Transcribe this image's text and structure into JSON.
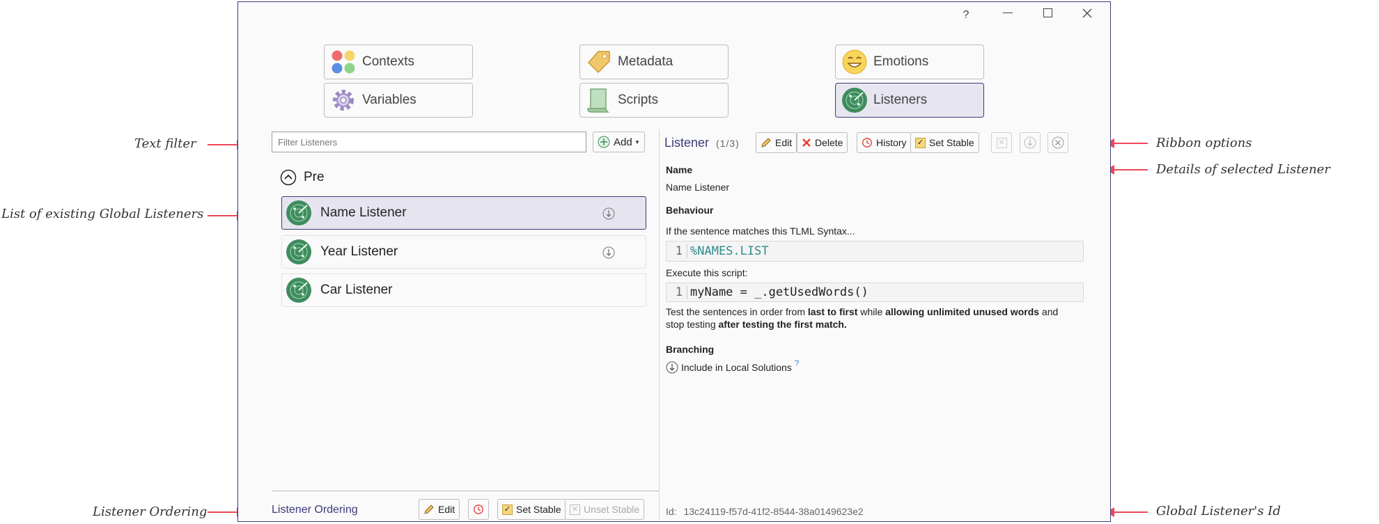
{
  "callouts": {
    "text_filter": "Text filter",
    "list_existing": "List of existing Global Listeners",
    "listener_ordering": "Listener Ordering",
    "ribbon_options": "Ribbon options",
    "details_selected": "Details of selected Listener",
    "global_id": "Global Listener's Id"
  },
  "window": {
    "help": "?",
    "minimize": "—",
    "maximize": "☐",
    "close": "✕"
  },
  "nav": {
    "contexts": "Contexts",
    "metadata": "Metadata",
    "emotions": "Emotions",
    "variables": "Variables",
    "scripts": "Scripts",
    "listeners": "Listeners"
  },
  "left": {
    "filter_placeholder": "Filter Listeners",
    "add_label": "Add",
    "group_name": "Pre",
    "items": [
      {
        "label": "Name Listener"
      },
      {
        "label": "Year Listener"
      },
      {
        "label": "Car Listener"
      }
    ],
    "footer": {
      "title": "Listener Ordering",
      "edit": "Edit",
      "set_stable": "Set Stable",
      "unset_stable": "Unset Stable"
    }
  },
  "right": {
    "title": "Listener",
    "count": "(1/3)",
    "ribbon": {
      "edit": "Edit",
      "delete": "Delete",
      "history": "History",
      "set_stable": "Set Stable"
    },
    "name_label": "Name",
    "name_value": "Name Listener",
    "behaviour_label": "Behaviour",
    "matches_text": "If the sentence matches this TLML Syntax...",
    "syntax_line_no": "1",
    "syntax_code": "%NAMES.LIST",
    "execute_text": "Execute this script:",
    "script_line_no": "1",
    "script_code": "myName = _.getUsedWords()",
    "test_text": {
      "p1": "Test the sentences in order from ",
      "b1": "last to first",
      "p2": " while ",
      "b2": "allowing unlimited unused words",
      "p3": " and",
      "p4": "stop testing ",
      "b3": "after testing the first match."
    },
    "branching_label": "Branching",
    "branching_text": "Include in Local Solutions",
    "branching_help": "?",
    "id_label": "Id:",
    "id_value": "13c24119-f57d-41f2-8544-38a0149623e2"
  },
  "colors": {
    "accent": "#3c3a7a",
    "arrow": "#f04657",
    "listener_icon": "#3f8c5e",
    "delete_red": "#e53935",
    "stable_yellow": "#f6d77a"
  }
}
